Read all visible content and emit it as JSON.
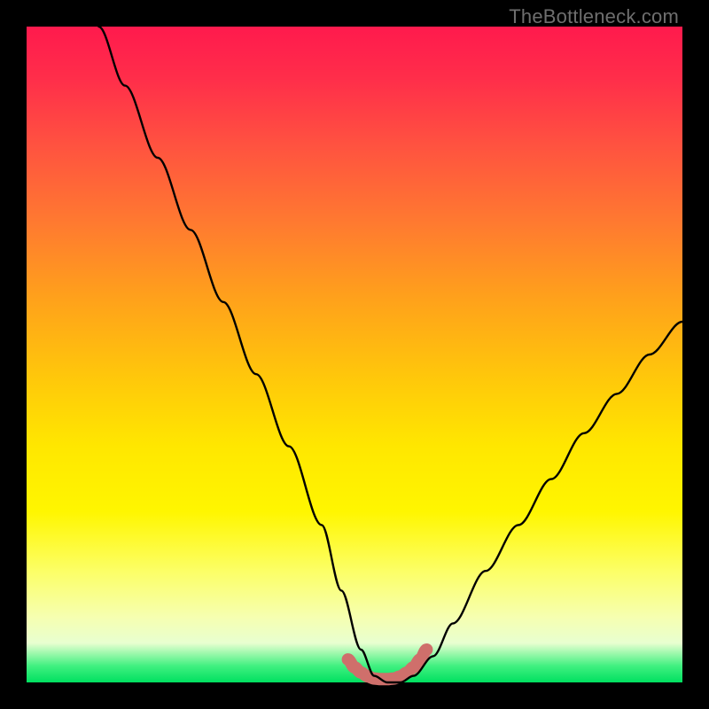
{
  "watermark": "TheBottleneck.com",
  "chart_data": {
    "type": "line",
    "title": "",
    "xlabel": "",
    "ylabel": "",
    "xlim": [
      0,
      100
    ],
    "ylim": [
      0,
      100
    ],
    "series": [
      {
        "name": "bottleneck-curve",
        "x": [
          11,
          15,
          20,
          25,
          30,
          35,
          40,
          45,
          48,
          51,
          53,
          55,
          57,
          59,
          62,
          65,
          70,
          75,
          80,
          85,
          90,
          95,
          100
        ],
        "values": [
          100,
          91,
          80,
          69,
          58,
          47,
          36,
          24,
          14,
          5,
          1,
          0,
          0,
          1,
          4,
          9,
          17,
          24,
          31,
          38,
          44,
          50,
          55
        ]
      },
      {
        "name": "highlight-band",
        "x": [
          49,
          50,
          51,
          52,
          53,
          54,
          55,
          56,
          57,
          58,
          59,
          60,
          61
        ],
        "values": [
          3.5,
          2.3,
          1.5,
          0.9,
          0.6,
          0.5,
          0.5,
          0.6,
          0.9,
          1.5,
          2.3,
          3.5,
          5
        ]
      }
    ],
    "colors": {
      "curve": "#000000",
      "highlight": "#cf6f6b"
    }
  }
}
